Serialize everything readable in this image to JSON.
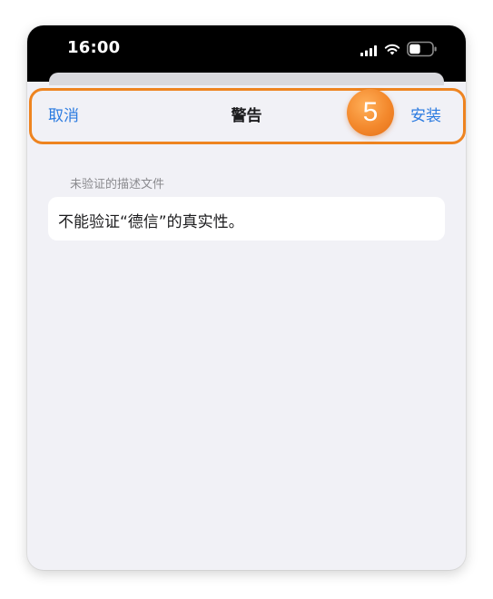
{
  "status_bar": {
    "time": "16:00"
  },
  "nav": {
    "cancel_label": "取消",
    "title": "警告",
    "install_label": "安装"
  },
  "step_badge": "5",
  "section": {
    "header": "未验证的描述文件",
    "message": "不能验证“德信”的真实性。"
  },
  "colors": {
    "accent_blue": "#2b7be0",
    "highlight_orange": "#ee8420",
    "background": "#f1f1f6"
  },
  "icons": [
    "signal-icon",
    "wifi-icon",
    "battery-icon"
  ]
}
